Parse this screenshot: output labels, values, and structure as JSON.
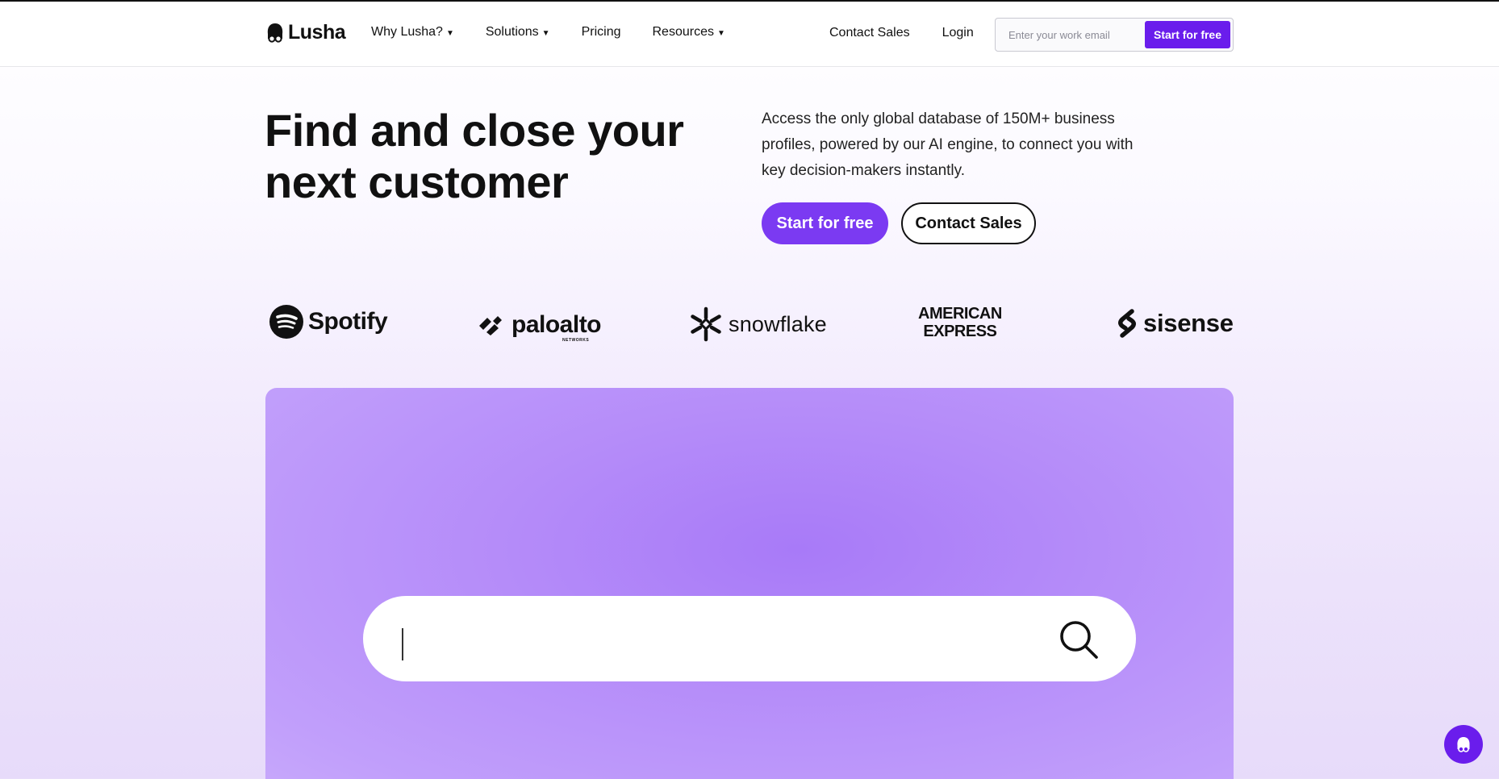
{
  "header": {
    "brand": "Lusha",
    "nav": [
      {
        "label": "Why Lusha?",
        "dropdown": true
      },
      {
        "label": "Solutions",
        "dropdown": true
      },
      {
        "label": "Pricing",
        "dropdown": false
      },
      {
        "label": "Resources",
        "dropdown": true
      }
    ],
    "contact_sales": "Contact Sales",
    "login": "Login",
    "email_placeholder": "Enter your work email",
    "email_button": "Start for free"
  },
  "hero": {
    "title_line1": "Find and close your",
    "title_line2": "next customer",
    "description": "Access the only global database of 150M+ business profiles, powered by our AI engine, to connect you with key decision-makers instantly.",
    "primary_cta": "Start for free",
    "secondary_cta": "Contact Sales"
  },
  "logos": {
    "spotify": "Spotify",
    "paloalto": "paloalto",
    "paloalto_sub": "NETWORKS",
    "snowflake": "snowflake",
    "amex_line1": "AMERICAN",
    "amex_line2": "EXPRESS",
    "sisense": "sisense"
  },
  "search": {
    "value": "",
    "icon": "search-icon"
  },
  "chat": {
    "icon": "lusha-chat-icon"
  },
  "colors": {
    "accent": "#6a1dec",
    "cta": "#7b3af2",
    "panel": "#b58cf9"
  }
}
